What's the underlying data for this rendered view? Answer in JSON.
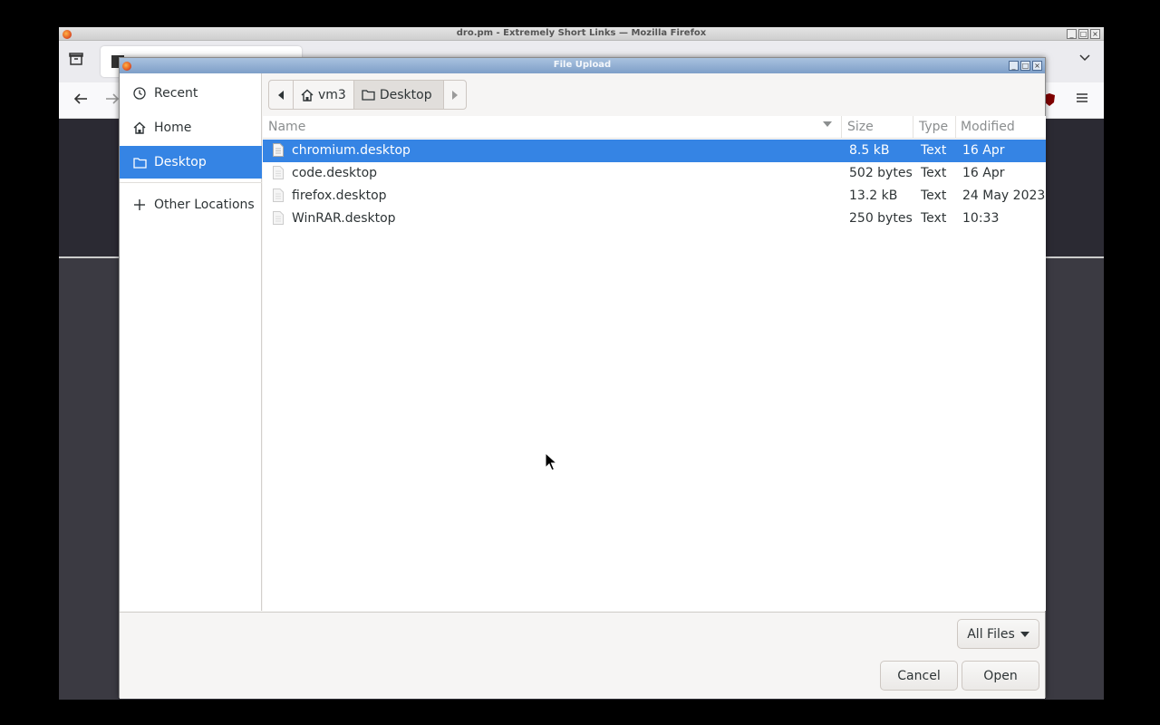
{
  "browser": {
    "window_title": "dro.pm - Extremely Short Links — Mozilla Firefox"
  },
  "dialog": {
    "title": "File Upload",
    "sidebar": {
      "items": [
        {
          "label": "Recent",
          "icon": "clock-icon"
        },
        {
          "label": "Home",
          "icon": "home-icon"
        },
        {
          "label": "Desktop",
          "icon": "folder-icon",
          "active": true
        },
        {
          "label": "Other Locations",
          "icon": "plus-icon"
        }
      ]
    },
    "pathbar": {
      "segments": [
        {
          "label": "vm3",
          "icon": "home-icon"
        },
        {
          "label": "Desktop",
          "icon": "folder-icon",
          "current": true
        }
      ]
    },
    "columns": {
      "name": "Name",
      "size": "Size",
      "type": "Type",
      "modified": "Modified"
    },
    "files": [
      {
        "name": "chromium.desktop",
        "size": "8.5 kB",
        "type": "Text",
        "modified": "16 Apr",
        "selected": true
      },
      {
        "name": "code.desktop",
        "size": "502 bytes",
        "type": "Text",
        "modified": "16 Apr"
      },
      {
        "name": "firefox.desktop",
        "size": "13.2 kB",
        "type": "Text",
        "modified": "24 May 2023"
      },
      {
        "name": "WinRAR.desktop",
        "size": "250 bytes",
        "type": "Text",
        "modified": "10:33"
      }
    ],
    "filter": {
      "selected": "All Files"
    },
    "buttons": {
      "cancel": "Cancel",
      "open": "Open"
    }
  },
  "colors": {
    "selection": "#3584e4",
    "dialog_titlebar": "#7e9fc8"
  }
}
